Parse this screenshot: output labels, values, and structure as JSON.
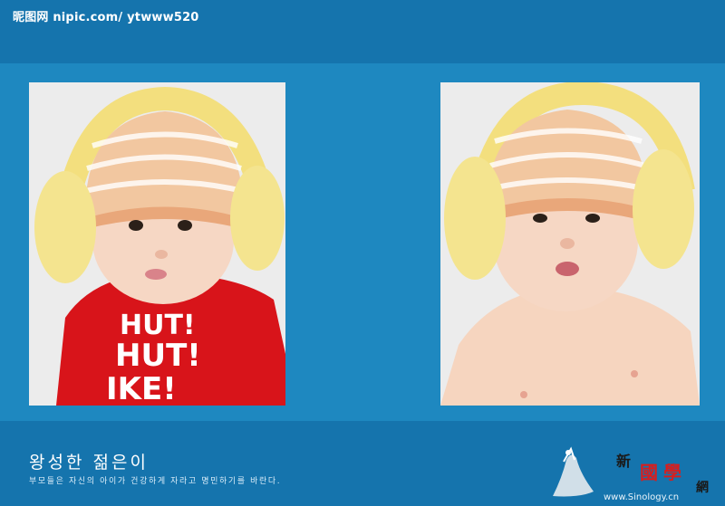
{
  "header": {
    "watermark": "昵图网 nipic.com/ ytwww520"
  },
  "photos": {
    "left_shirt_text": [
      "HUT!",
      "HUT!",
      "IKE!"
    ]
  },
  "footer": {
    "title": "왕성한 젊은이",
    "subtitle": "부모들은 자신의 아이가 건강하게 자라고 명민하기를 바란다."
  },
  "logo": {
    "char_1": "新",
    "char_2": "國",
    "char_3": "學",
    "char_4": "網",
    "url": "www.Sinology.cn"
  },
  "colors": {
    "page_background": "#1574ad",
    "panel_background": "#1e88c0",
    "logo_red": "#d81e1e"
  }
}
